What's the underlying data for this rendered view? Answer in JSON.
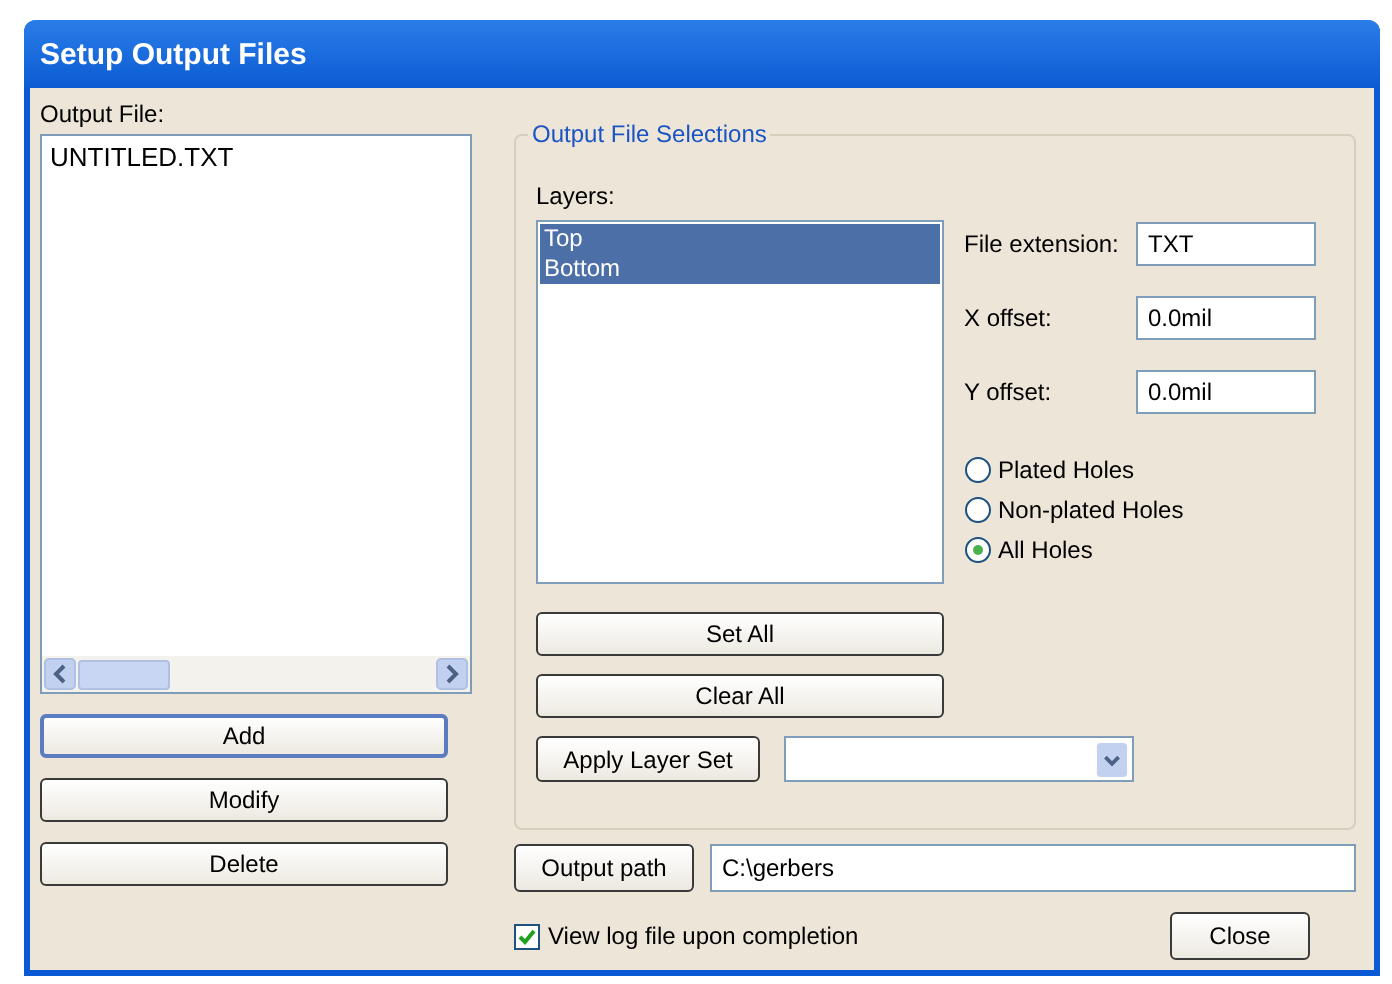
{
  "window": {
    "title": "Setup Output Files"
  },
  "output_file": {
    "label": "Output File:",
    "items": [
      {
        "text": "UNTITLED.TXT",
        "selected": false
      }
    ]
  },
  "file_buttons": [
    {
      "label": "Add",
      "default": true
    },
    {
      "label": "Modify",
      "default": false
    },
    {
      "label": "Delete",
      "default": false
    }
  ],
  "selections": {
    "title": "Output File Selections",
    "layers_label": "Layers:",
    "layers": [
      {
        "name": "Top",
        "selected": true
      },
      {
        "name": "Bottom",
        "selected": true
      }
    ],
    "fields": [
      {
        "label": "File extension:",
        "value": "TXT"
      },
      {
        "label": "X offset:",
        "value": "0.0mil"
      },
      {
        "label": "Y offset:",
        "value": "0.0mil"
      }
    ],
    "holes": [
      {
        "label": "Plated Holes",
        "selected": false
      },
      {
        "label": "Non-plated Holes",
        "selected": false
      },
      {
        "label": "All Holes",
        "selected": true
      }
    ],
    "buttons": [
      "Set All",
      "Clear All"
    ],
    "apply_button": "Apply Layer Set"
  },
  "output_path": {
    "button": "Output path",
    "value": "C:\\gerbers"
  },
  "view_log": {
    "label": "View log file upon completion",
    "checked": true
  },
  "close_button": "Close"
}
